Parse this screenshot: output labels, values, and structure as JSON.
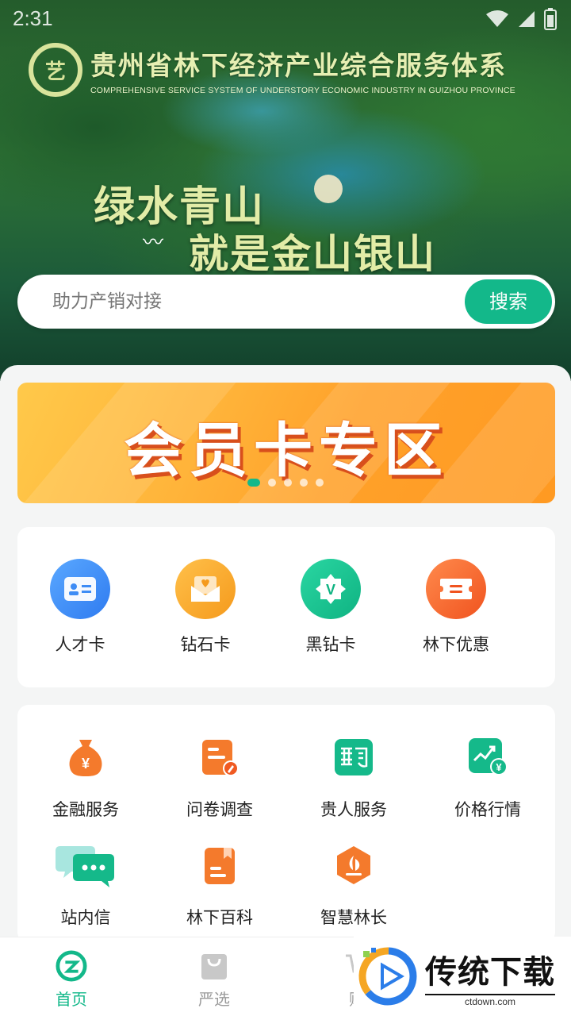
{
  "status_bar": {
    "time": "2:31"
  },
  "header": {
    "logo_mark": "艺",
    "title": "贵州省林下经济产业综合服务体系",
    "subtitle": "COMPREHENSIVE SERVICE SYSTEM OF UNDERSTORY ECONOMIC INDUSTRY IN GUIZHOU PROVINCE",
    "slogan_line1": "绿水青山",
    "slogan_line2": "就是金山银山"
  },
  "search": {
    "placeholder": "助力产销对接",
    "button_label": "搜索"
  },
  "banner": {
    "title": "会员卡专区",
    "page_count": 5,
    "active_page": 1
  },
  "membership": [
    {
      "label": "人才卡",
      "icon": "id-card-icon",
      "color": "#3d8cf5"
    },
    {
      "label": "钻石卡",
      "icon": "envelope-heart-icon",
      "color": "#f7a52c"
    },
    {
      "label": "黑钻卡",
      "icon": "v-badge-icon",
      "color": "#12c18e"
    },
    {
      "label": "林下优惠",
      "icon": "coupon-icon",
      "color": "#f4602b"
    }
  ],
  "services": [
    {
      "label": "金融服务",
      "icon": "money-bag-icon"
    },
    {
      "label": "问卷调查",
      "icon": "questionnaire-icon"
    },
    {
      "label": "贵人服务",
      "icon": "guiren-icon"
    },
    {
      "label": "价格行情",
      "icon": "price-trend-icon"
    },
    {
      "label": "站内信",
      "icon": "message-icon"
    },
    {
      "label": "林下百科",
      "icon": "encyclopedia-icon"
    },
    {
      "label": "智慧林长",
      "icon": "smart-forest-icon"
    }
  ],
  "bottom_nav": [
    {
      "label": "首页",
      "icon": "home-logo-icon",
      "active": true
    },
    {
      "label": "严选",
      "icon": "shopping-bag-icon",
      "active": false
    },
    {
      "label": "购",
      "icon": "cart-icon",
      "active": false
    }
  ],
  "watermark": {
    "title": "传统下载",
    "url": "ctdown.com"
  },
  "colors": {
    "accent": "#13b88a",
    "banner_orange": "#ffa12a"
  }
}
